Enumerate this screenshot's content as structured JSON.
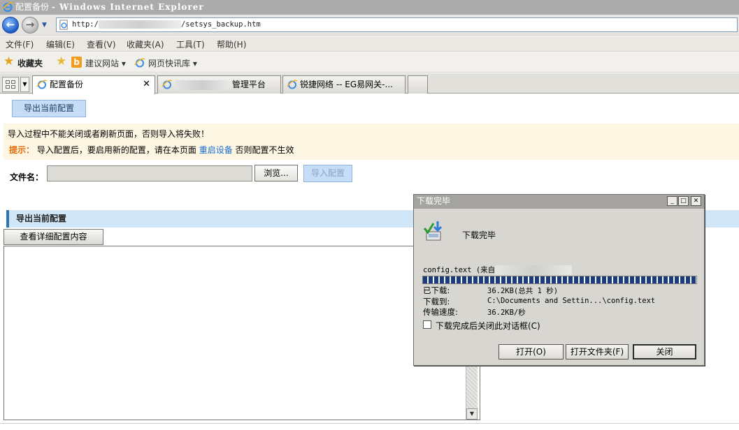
{
  "window": {
    "title": "配置备份",
    "app_name": "- Windows Internet Explorer"
  },
  "address": {
    "url_prefix": "http:/",
    "url_suffix": "/setsys_backup.htm"
  },
  "menu": [
    "文件(F)",
    "编辑(E)",
    "查看(V)",
    "收藏夹(A)",
    "工具(T)",
    "帮助(H)"
  ],
  "favorites": {
    "label": "收藏夹",
    "items": [
      "建议网站 ▾",
      "网页快讯库 ▾"
    ]
  },
  "tabs": [
    {
      "label": "配置备份",
      "active": true
    },
    {
      "label": "管理平台",
      "active": false
    },
    {
      "label": "锐捷网络 -- EG易网关-...",
      "active": false
    }
  ],
  "page": {
    "export_button": "导出当前配置",
    "notice_line1": "导入过程中不能关闭或者刷新页面，否则导入将失败！",
    "notice_tip_label": "提示：",
    "notice_tip_text": "导入配置后，要启用新的配置，请在本页面",
    "notice_link": "重启设备",
    "notice_tip_tail": "否则配置不生效",
    "file_label": "文件名：",
    "browse_button": "浏览...",
    "import_button": "导入配置",
    "section_title": "导出当前配置",
    "view_button": "查看详细配置内容"
  },
  "dialog": {
    "title": "下载完毕",
    "heading": "下载完毕",
    "file_line": "config.text (来自",
    "progress_fraction": 1.0,
    "rows": [
      {
        "label": "已下载:",
        "value": "36.2KB(总共 1 秒)"
      },
      {
        "label": "下载到:",
        "value": "C:\\Documents and Settin...\\config.text"
      },
      {
        "label": "传输速度:",
        "value": "36.2KB/秒"
      }
    ],
    "checkbox_label": "下载完成后关闭此对话框(C)",
    "buttons": {
      "open": "打开(O)",
      "open_folder": "打开文件夹(F)",
      "close": "关闭"
    }
  },
  "colors": {
    "accent_button": "#c5ddf6",
    "tip_orange": "#e36c09",
    "link_blue": "#1a6fd4",
    "section_bar": "#d1e6f6",
    "progress_blue": "#1c3b7f"
  }
}
